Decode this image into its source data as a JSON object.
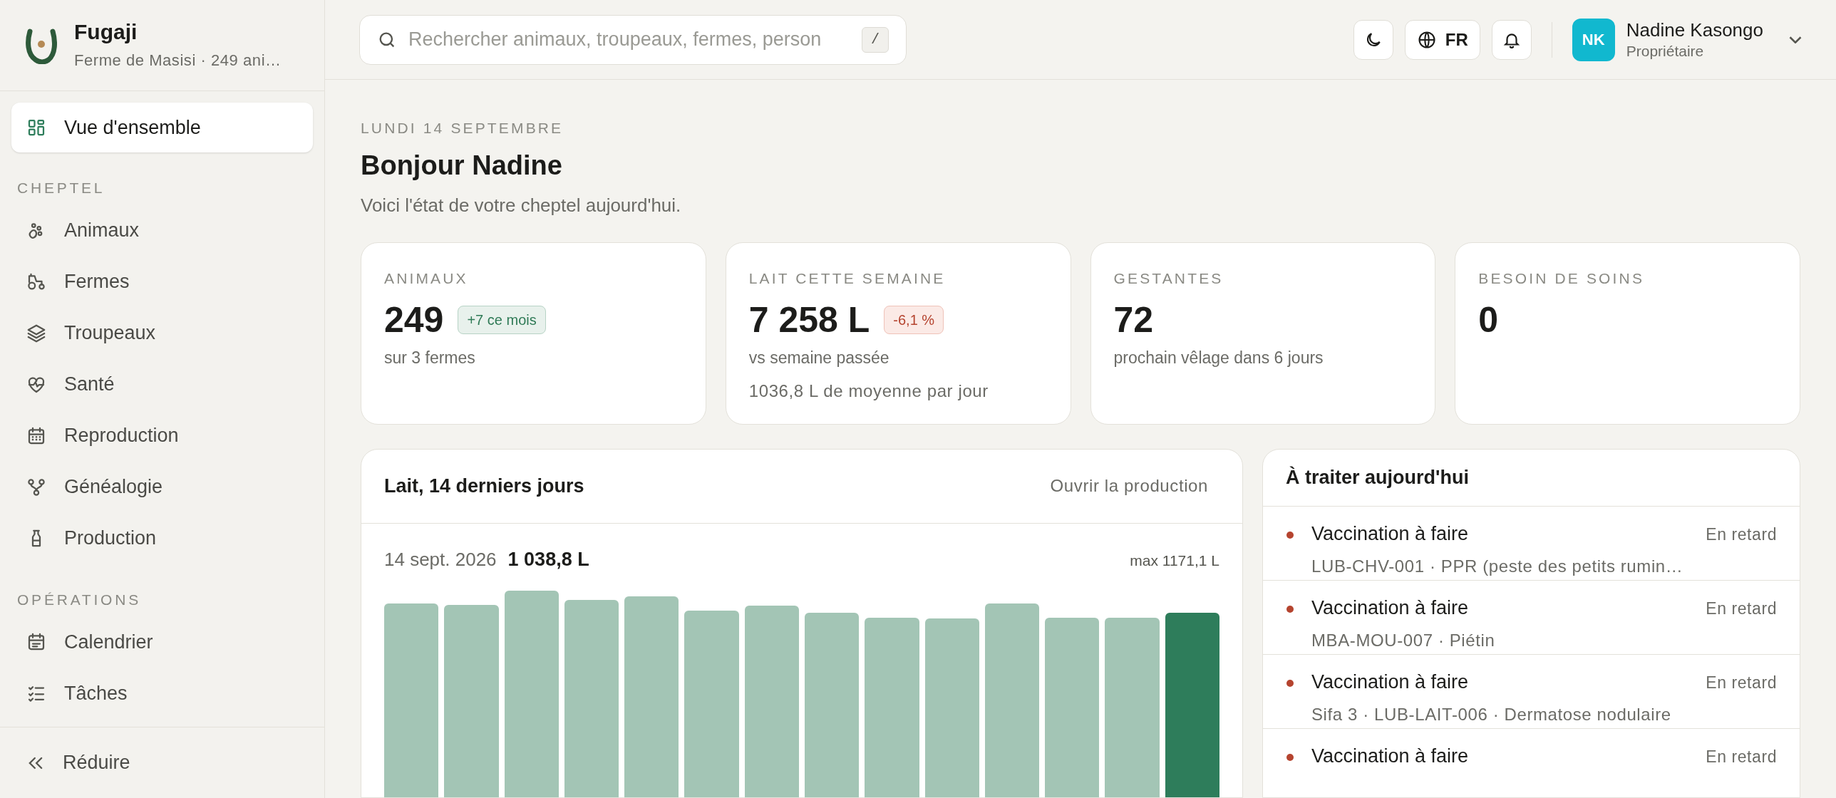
{
  "sidebar": {
    "brand": {
      "name": "Fugaji",
      "subtitle": "Ferme de Masisi · 249 ani…"
    },
    "top_item": {
      "label": "Vue d'ensemble",
      "selected": true
    },
    "sections": [
      {
        "title": "CHEPTEL",
        "items": [
          {
            "label": "Animaux",
            "selected": false
          },
          {
            "label": "Fermes",
            "selected": false
          },
          {
            "label": "Troupeaux",
            "selected": false
          },
          {
            "label": "Santé",
            "selected": false
          },
          {
            "label": "Reproduction",
            "selected": false
          },
          {
            "label": "Généalogie",
            "selected": false
          },
          {
            "label": "Production",
            "selected": false
          }
        ]
      },
      {
        "title": "OPÉRATIONS",
        "items": [
          {
            "label": "Calendrier",
            "selected": false
          },
          {
            "label": "Tâches",
            "selected": false
          }
        ]
      }
    ],
    "collapse_button": "Réduire"
  },
  "topbar": {
    "search": {
      "placeholder": "Rechercher animaux, troupeaux, fermes, person",
      "shortcut": "/"
    },
    "language": "FR",
    "user": {
      "initials": "NK",
      "name": "Nadine Kasongo",
      "role": "Propriétaire"
    }
  },
  "header": {
    "date": "LUNDI 14 SEPTEMBRE",
    "greeting": "Bonjour Nadine",
    "subtitle": "Voici l'état de votre cheptel aujourd'hui."
  },
  "stats": [
    {
      "label": "ANIMAUX",
      "value": "249",
      "badge": {
        "text": "+7 ce mois",
        "kind": "up"
      },
      "notes": [
        "sur 3 fermes"
      ]
    },
    {
      "label": "LAIT CETTE SEMAINE",
      "value": "7 258 L",
      "badge": {
        "text": "-6,1 %",
        "kind": "down"
      },
      "notes": [
        "vs semaine passée",
        "1036,8 L de moyenne par jour"
      ]
    },
    {
      "label": "GESTANTES",
      "value": "72",
      "notes": [
        "prochain vêlage dans 6 jours"
      ]
    },
    {
      "label": "BESOIN DE SOINS",
      "value": "0"
    }
  ],
  "milk_panel": {
    "title": "Lait, 14 derniers jours",
    "link": "Ouvrir la production",
    "date": "14 sept. 2026",
    "value": "1 038,8 L",
    "max": "max 1171,1 L"
  },
  "tasks": {
    "title": "À traiter aujourd'hui",
    "items": [
      {
        "title": "Vaccination à faire",
        "detail": "LUB-CHV-001 · PPR (peste des petits rumin…",
        "status": "En retard"
      },
      {
        "title": "Vaccination à faire",
        "detail": "MBA-MOU-007 · Piétin",
        "status": "En retard"
      },
      {
        "title": "Vaccination à faire",
        "detail": "Sifa 3 · LUB-LAIT-006 · Dermatose nodulaire",
        "status": "En retard"
      },
      {
        "title": "Vaccination à faire",
        "status": "En retard"
      }
    ]
  }
}
